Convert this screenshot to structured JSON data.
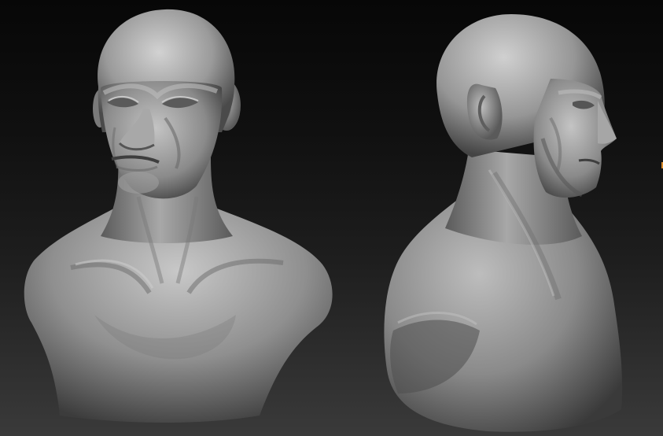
{
  "scene": {
    "background_top": "#070707",
    "background_bottom": "#3a3a3a",
    "clay_light": "#cfcfcf",
    "clay_mid": "#8c8c8c",
    "clay_dark": "#3e3e3e",
    "edge_marker_color": "#d98b2b",
    "views": [
      {
        "view": "front-three-quarter"
      },
      {
        "view": "right-profile-three-quarter"
      }
    ]
  }
}
